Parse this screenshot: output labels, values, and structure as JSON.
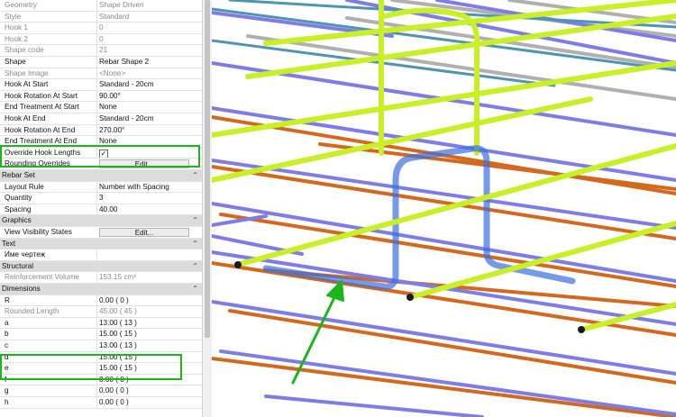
{
  "properties": {
    "rows": [
      {
        "label": "Geometry",
        "value": "Shape Driven",
        "dis": true
      },
      {
        "label": "Style",
        "value": "Standard",
        "dis": true
      },
      {
        "label": "Hook 1",
        "value": "0",
        "dis": true
      },
      {
        "label": "Hook 2",
        "value": "0",
        "dis": true
      },
      {
        "label": "Shape code",
        "value": "21",
        "dis": true
      },
      {
        "label": "Shape",
        "value": "Rebar Shape 2"
      },
      {
        "label": "Shape Image",
        "value": "<None>",
        "dis": true
      },
      {
        "label": "Hook At Start",
        "value": "Standard - 20cm"
      },
      {
        "label": "Hook Rotation At Start",
        "value": "90.00°"
      },
      {
        "label": "End Treatment At Start",
        "value": "None"
      },
      {
        "label": "Hook At End",
        "value": "Standard - 20cm"
      },
      {
        "label": "Hook Rotation At End",
        "value": "270.00°"
      },
      {
        "label": "End Treatment At End",
        "value": "None"
      },
      {
        "label": "Override Hook Lengths",
        "checkbox": true,
        "checked": true
      },
      {
        "label": "Rounding Overrides",
        "button": "Edit..."
      },
      {
        "label": "Rebar Set",
        "header": true
      },
      {
        "label": "Layout Rule",
        "value": "Number with Spacing"
      },
      {
        "label": "Quantity",
        "value": "3"
      },
      {
        "label": "Spacing",
        "value": "40.00"
      },
      {
        "label": "Graphics",
        "header": true
      },
      {
        "label": "View Visibility States",
        "button": "Edit..."
      },
      {
        "label": "Text",
        "header": true
      },
      {
        "label": "Имe чертеж",
        "value": ""
      },
      {
        "label": "Structural",
        "header": true
      },
      {
        "label": "Reinforcement Volume",
        "value": "153.15 cm³",
        "dis": true
      },
      {
        "label": "Dimensions",
        "header": true
      },
      {
        "label": "R",
        "value": "0.00 ( 0 )"
      },
      {
        "label": "Rounded Length",
        "value": "45.00 ( 45 )",
        "dis": true
      },
      {
        "label": "a",
        "value": "13.00 ( 13 )"
      },
      {
        "label": "b",
        "value": "15.00 ( 15 )"
      },
      {
        "label": "c",
        "value": "13.00 ( 13 )"
      },
      {
        "label": "d",
        "value": "15.00 ( 15 )"
      },
      {
        "label": "e",
        "value": "15.00 ( 15 )"
      },
      {
        "label": "f",
        "value": "0.00 ( 0 )"
      },
      {
        "label": "g",
        "value": "0.00 ( 0 )"
      },
      {
        "label": "h",
        "value": "0.00 ( 0 )"
      }
    ]
  },
  "viewport": {
    "colors": {
      "yellow_green": "#c8ef28",
      "blue": "#7e7de6",
      "orange": "#d2691e",
      "gray": "#b0b0b0",
      "teal": "#4d95b0",
      "selected": "#3a6fe0",
      "highlight": "#1cb51c"
    }
  }
}
